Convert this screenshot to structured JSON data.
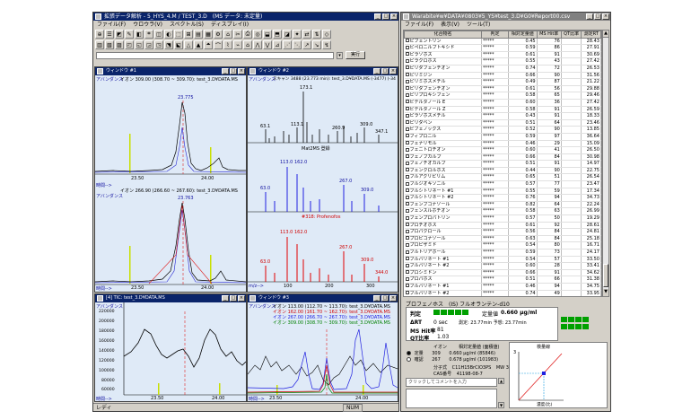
{
  "main_window": {
    "title": "拡張データ解析 - 5_HYS_4.M / TEST_3.D　(MS データ: 未定量)",
    "menu": [
      "ファイル(F)",
      "ウロウラ(V)",
      "スペクトル(S)",
      "ディスプレイ(I)"
    ],
    "run_button": "実行",
    "status_left": "レディ",
    "status_right": "NUM"
  },
  "plots": {
    "tl": {
      "title": "ウィンドウ #1",
      "top_header": "イオン 309.00 (308.70 ~ 309.70): test_3.D¥DATA.MS",
      "top_ylabel": "アバンダンス",
      "top_peak": "23.775",
      "top_ticks": [
        "23.50",
        "24.00"
      ],
      "top_xlabel": "時間-->",
      "bot_header": "イオン 266.90 (266.60 ~ 267.60): test_3.D¥DATA.MS",
      "bot_ylabel": "アバンダンス",
      "bot_peak": "23.763",
      "bot_ticks": [
        "23.50",
        "24.00"
      ],
      "bot_xlabel": "時間-->"
    },
    "tr": {
      "title": "ウィンドウ #2",
      "ylabel": "アバンダンス",
      "header": "スキャン 3488 (23.773 min): test_3.D¥DATA.MS (-3477) (-34",
      "top_labels": [
        "173.1",
        "63.1",
        "113.1",
        "260.9",
        "309.0",
        "347.1"
      ],
      "mid_title": "Mat2MS 登録",
      "mid_labels": [
        "113.0",
        "162.0",
        "63.0",
        "267.0",
        "309.0"
      ],
      "bot_title": "#318: Profenofos",
      "bot_labels": [
        "113.0",
        "162.0",
        "63.0",
        "267.0",
        "309.0",
        "344.0"
      ],
      "ticks": [
        "100",
        "200",
        "300"
      ],
      "xlabel": "m/z-->"
    },
    "bl": {
      "title": "[4] TIC: test_3.D¥DATA.MS",
      "ylabel": "アバンダンス",
      "yticks": [
        "220000",
        "200000",
        "180000",
        "160000",
        "140000",
        "120000",
        "100000",
        "80000",
        "60000"
      ],
      "ticks": [
        "23.50",
        "24.00"
      ],
      "xlabel": "時間-->"
    },
    "bc": {
      "title": "ウィンドウ #3",
      "ylabel": "アバンダンス",
      "legend": [
        {
          "text": "イオン 113.00 (112.70 ~ 113.70): test_3.D¥DATA.MS",
          "color": "#000000"
        },
        {
          "text": "イオン 162.00 (161.70 ~ 162.70): test_3.D¥DATA.MS",
          "color": "#d00000"
        },
        {
          "text": "イオン 267.00 (266.70 ~ 267.70): test_3.D¥DATA.MS",
          "color": "#2020e0"
        },
        {
          "text": "イオン 309.00 (308.70 ~ 309.70): test_3.D¥DATA.MS",
          "color": "#008000"
        }
      ],
      "ticks": [
        "23.50",
        "24.00"
      ],
      "xlabel": "時間-->"
    }
  },
  "right_window": {
    "title": "Warabite¥w¥DATA¥0803¥5_YS¥test_3.D¥G0¥Report00.csv",
    "menu": [
      "ファイル(F)",
      "表示(V)",
      "ツール(T)"
    ],
    "headers": [
      "化合物名",
      "判定",
      "相対定量値",
      "MS Hit率",
      "QT比率",
      "測定RT"
    ],
    "rows": [
      [
        "ピフェントリン",
        "*****",
        "0.45",
        "76",
        "28.43"
      ],
      [
        "ピペロニルブトキシド",
        "*****",
        "0.59",
        "86",
        "27.91"
      ],
      [
        "ピラゾホス",
        "*****",
        "0.61",
        "91",
        "30.69"
      ],
      [
        "ピラクロホス",
        "*****",
        "0.55",
        "43",
        "27.42"
      ],
      [
        "ピリダフェンチオン",
        "*****",
        "0.74",
        "72",
        "26.53"
      ],
      [
        "ピリミジン",
        "*****",
        "0.66",
        "90",
        "31.56"
      ],
      [
        "ピリミホスメチル",
        "*****",
        "0.49",
        "87",
        "21.22"
      ],
      [
        "ピリダフェンチオン",
        "*****",
        "0.61",
        "56",
        "29.88"
      ],
      [
        "ピリプロキシフェン",
        "*****",
        "0.58",
        "65",
        "29.46"
      ],
      [
        "ビテルタノール E",
        "*****",
        "0.60",
        "36",
        "27.42"
      ],
      [
        "ビテルタノール Z",
        "*****",
        "0.58",
        "91",
        "26.59"
      ],
      [
        "ピラゾホスメチル",
        "*****",
        "0.43",
        "91",
        "18.33"
      ],
      [
        "ピリダベン",
        "*****",
        "0.51",
        "64",
        "23.46"
      ],
      [
        "ビフェノックス",
        "*****",
        "0.52",
        "90",
        "13.85"
      ],
      [
        "フィプロニル",
        "*****",
        "0.59",
        "97",
        "36.64"
      ],
      [
        "フェナリモル",
        "*****",
        "0.46",
        "29",
        "15.09"
      ],
      [
        "フェニトロチオン",
        "*****",
        "0.60",
        "41",
        "26.50"
      ],
      [
        "フェノブカルブ",
        "*****",
        "0.66",
        "84",
        "30.98"
      ],
      [
        "フェノチオカルブ",
        "*****",
        "0.51",
        "91",
        "14.97"
      ],
      [
        "フェンクロルホス",
        "*****",
        "0.44",
        "90",
        "22.75"
      ],
      [
        "フルアクリピリム",
        "*****",
        "0.65",
        "51",
        "26.54"
      ],
      [
        "フルジオキソニル",
        "*****",
        "0.57",
        "77",
        "23.47"
      ],
      [
        "フルシトリネート #1",
        "*****",
        "0.55",
        "59",
        "17.34"
      ],
      [
        "フルシトリネート #2",
        "*****",
        "0.76",
        "94",
        "34.73"
      ],
      [
        "フェンブコナゾール",
        "*****",
        "0.82",
        "64",
        "22.24"
      ],
      [
        "フェンスルホチオン",
        "*****",
        "0.58",
        "63",
        "26.99"
      ],
      [
        "フェンプロパトリン",
        "*****",
        "0.57",
        "50",
        "19.29"
      ],
      [
        "プロチオホス",
        "*****",
        "0.61",
        "92",
        "28.61"
      ],
      [
        "プロパクロール",
        "*****",
        "0.56",
        "84",
        "24.81"
      ],
      [
        "プロピコナゾール",
        "*****",
        "0.63",
        "84",
        "25.18"
      ],
      [
        "プロピザミド",
        "*****",
        "0.54",
        "80",
        "16.71"
      ],
      [
        "フルトリアホール",
        "*****",
        "0.59",
        "73",
        "24.17"
      ],
      [
        "フルバリネート #1",
        "*****",
        "0.54",
        "57",
        "33.50"
      ],
      [
        "フルバリネート #2",
        "*****",
        "0.60",
        "28",
        "33.41"
      ],
      [
        "プロシミドン",
        "*****",
        "0.66",
        "91",
        "34.62"
      ],
      [
        "プロパホス",
        "*****",
        "0.51",
        "66",
        "31.38"
      ],
      [
        "フルバリネート #1",
        "*****",
        "0.46",
        "94",
        "34.75"
      ],
      [
        "フルバリネート #2",
        "*****",
        "0.74",
        "49",
        "33.95"
      ],
      [
        "プロクロラズ",
        "*****",
        "0.72",
        "91",
        "23.88"
      ],
      [
        "プロモブチド",
        "*****",
        "0.69",
        "86",
        "16.25"
      ],
      [
        "プロフェノホス",
        "*****",
        "0.47",
        "67",
        "19.31"
      ],
      [
        "プロフェノホス",
        "*****",
        "0.66",
        "81",
        "23.77"
      ]
    ],
    "selected_row": 41,
    "panel_title": "プロフェノホス　(IS) フルオランテン-d10",
    "judgement_label": "判定",
    "conc_label": "定量値",
    "conc_value": "0.660 μg/ml",
    "drt_label": "ΔRT",
    "drt_value": "0 sec",
    "drt_detail": "測定: 23.77min  予想: 23.77min",
    "hit_label": "MS Hit率",
    "hit_value": "81",
    "qt_label": "QT比率",
    "qt_value": "1.03",
    "ion_label": "イオン",
    "rel_header": "相対定量値 (面積値)",
    "quant_label": "定量",
    "quant_ion": "309",
    "quant_value": "0.660 μg/ml (85846)",
    "conf_label": "確認",
    "conf_ion": "267",
    "conf_value": "0.678 μg/ml (101983)",
    "formula_label": "分子式",
    "formula_value": "C11H15BrClO3PS",
    "mw_label": "MW",
    "mw_value": "374.6",
    "cas_label": "CAS番号",
    "cas_value": "41198-08-7",
    "comment_placeholder": "クリックしてコメントを入力",
    "calib_title": "検量線",
    "calib_xlabel": "濃度(比)",
    "calib_y": "3"
  }
}
